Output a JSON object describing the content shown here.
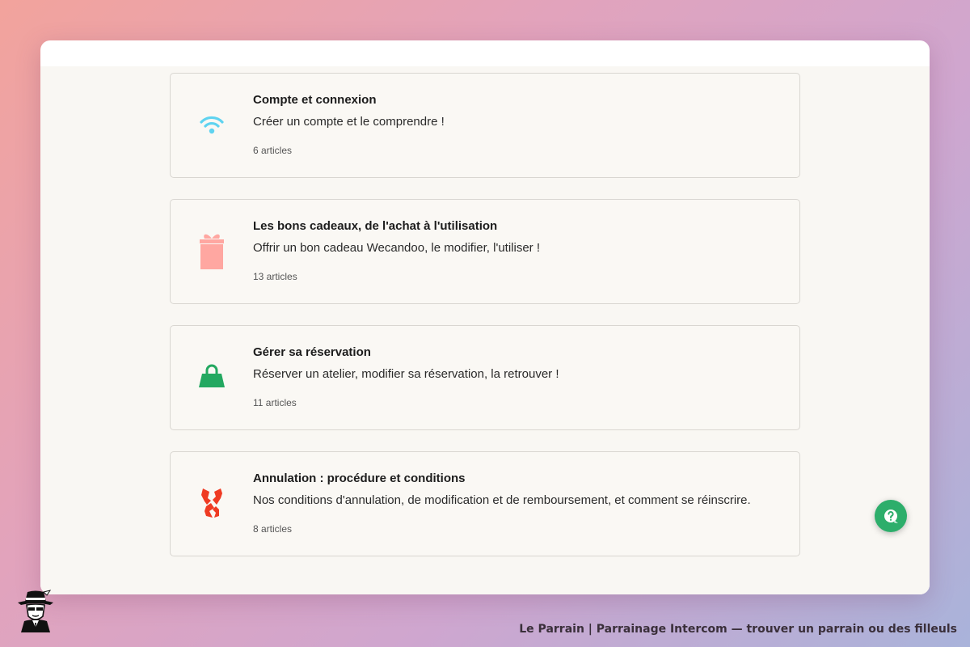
{
  "collections": [
    {
      "title": "Compte et connexion",
      "description": "Créer un compte et le comprendre !",
      "count": "6 articles",
      "icon": "wifi-icon",
      "icon_color": "#5fd3f0"
    },
    {
      "title": "Les bons cadeaux, de l'achat à l'utilisation",
      "description": "Offrir un bon cadeau Wecandoo, le modifier, l'utiliser !",
      "count": "13 articles",
      "icon": "gift-icon",
      "icon_color": "#ffa7a1"
    },
    {
      "title": "Gérer sa réservation",
      "description": "Réserver un atelier, modifier sa réservation, la retrouver !",
      "count": "11 articles",
      "icon": "shopping-bag-icon",
      "icon_color": "#23a860"
    },
    {
      "title": "Annulation : procédure et conditions",
      "description": "Nos conditions d'annulation, de modification et de remboursement, et comment se réinscrire.",
      "count": "8 articles",
      "icon": "torn-ribbon-icon",
      "icon_color": "#ef3b23"
    }
  ],
  "help_button": {
    "icon": "help-question-icon",
    "color": "#2dae6b"
  },
  "footer": {
    "text": "Le Parrain | Parrainage Intercom — trouver un parrain ou des filleuls",
    "logo_icon": "gangster-logo-icon"
  }
}
